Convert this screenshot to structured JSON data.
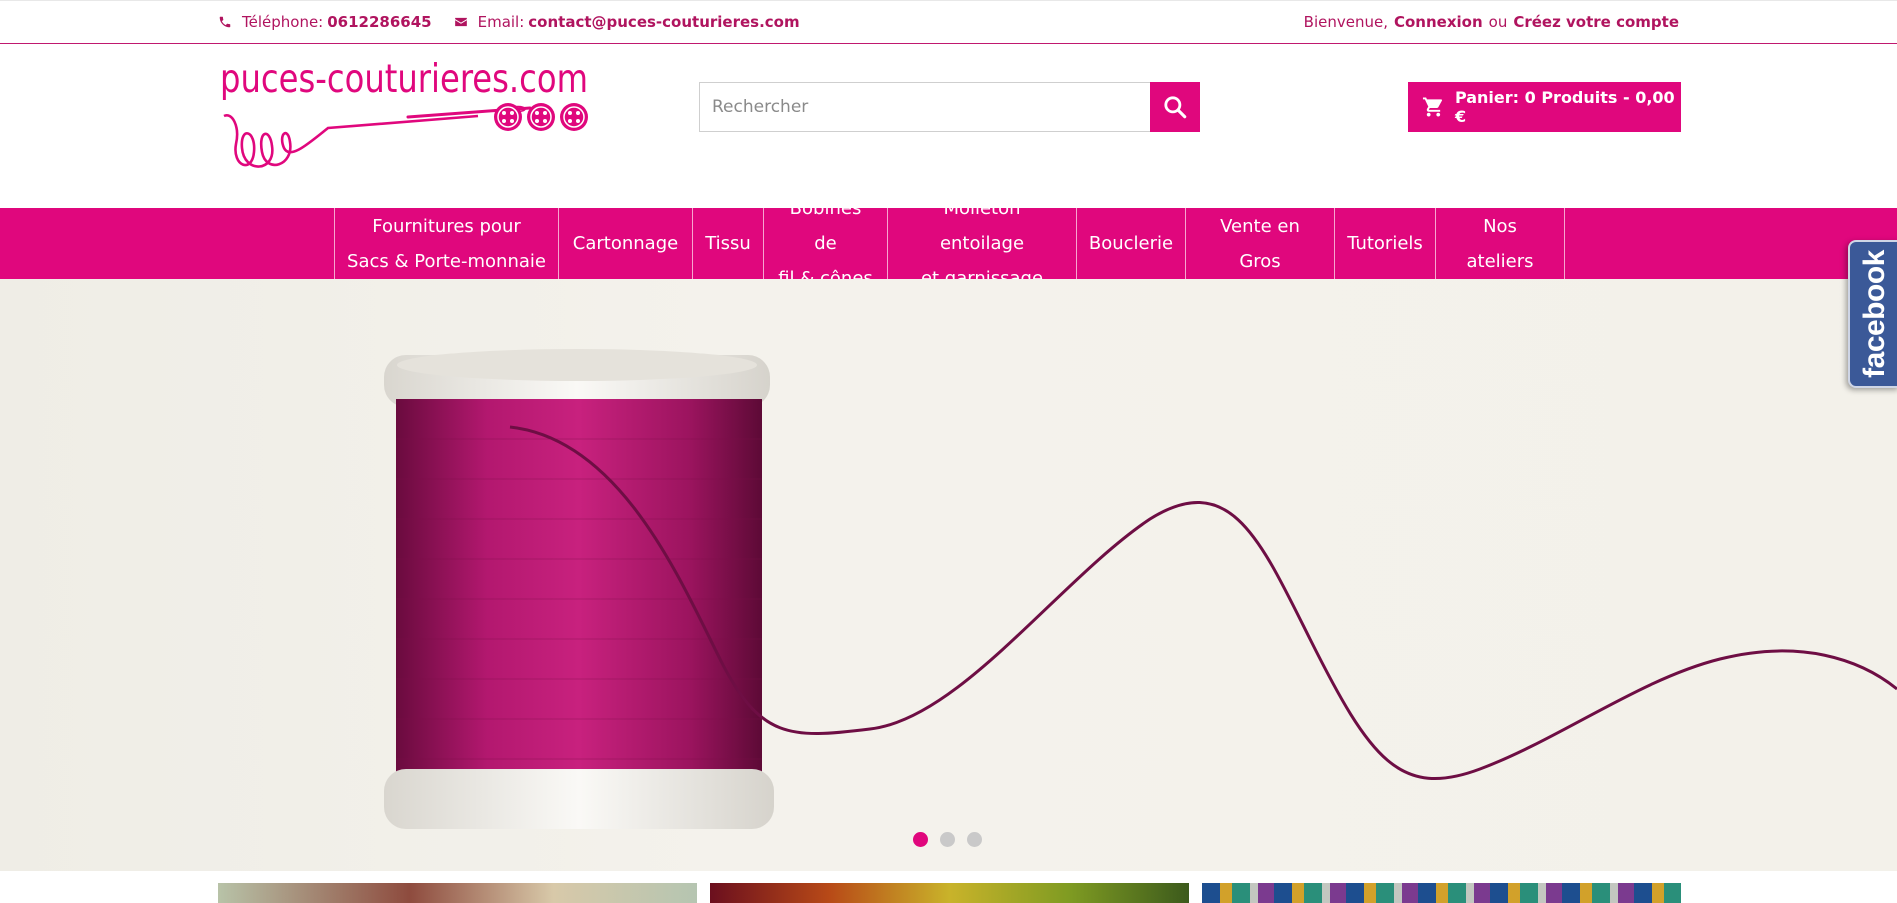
{
  "topbar": {
    "phone_label": "Téléphone:",
    "phone_value": "0612286645",
    "email_label": "Email:",
    "email_value": "contact@puces-couturieres.com",
    "welcome": "Bienvenue,",
    "login": "Connexion",
    "or": "ou",
    "register": "Créez votre compte"
  },
  "logo": {
    "text": "puces-couturieres.com"
  },
  "search": {
    "placeholder": "Rechercher"
  },
  "cart": {
    "label": "Panier: 0 Produits - 0,00 €"
  },
  "nav": {
    "items": [
      {
        "line1": "Fournitures pour",
        "line2": "Sacs & Porte-monnaie"
      },
      {
        "line1": "Cartonnage",
        "line2": ""
      },
      {
        "line1": "Tissu",
        "line2": ""
      },
      {
        "line1": "Bobines de",
        "line2": "fil & cônes"
      },
      {
        "line1": "Molleton entoilage",
        "line2": "et garnissage"
      },
      {
        "line1": "Bouclerie",
        "line2": ""
      },
      {
        "line1": "Vente en Gros",
        "line2": ""
      },
      {
        "line1": "Tutoriels",
        "line2": ""
      },
      {
        "line1": "Nos ateliers",
        "line2": ""
      }
    ]
  },
  "slider": {
    "slide_count": 3,
    "active_slide": 1
  },
  "facebook": {
    "label": "facebook"
  },
  "colors": {
    "brand": "#e0077d",
    "brand_dark": "#b0145f",
    "facebook": "#3b5998"
  },
  "icons": {
    "phone": "phone-icon",
    "email": "envelope-icon",
    "search": "search-icon",
    "cart": "cart-icon"
  }
}
